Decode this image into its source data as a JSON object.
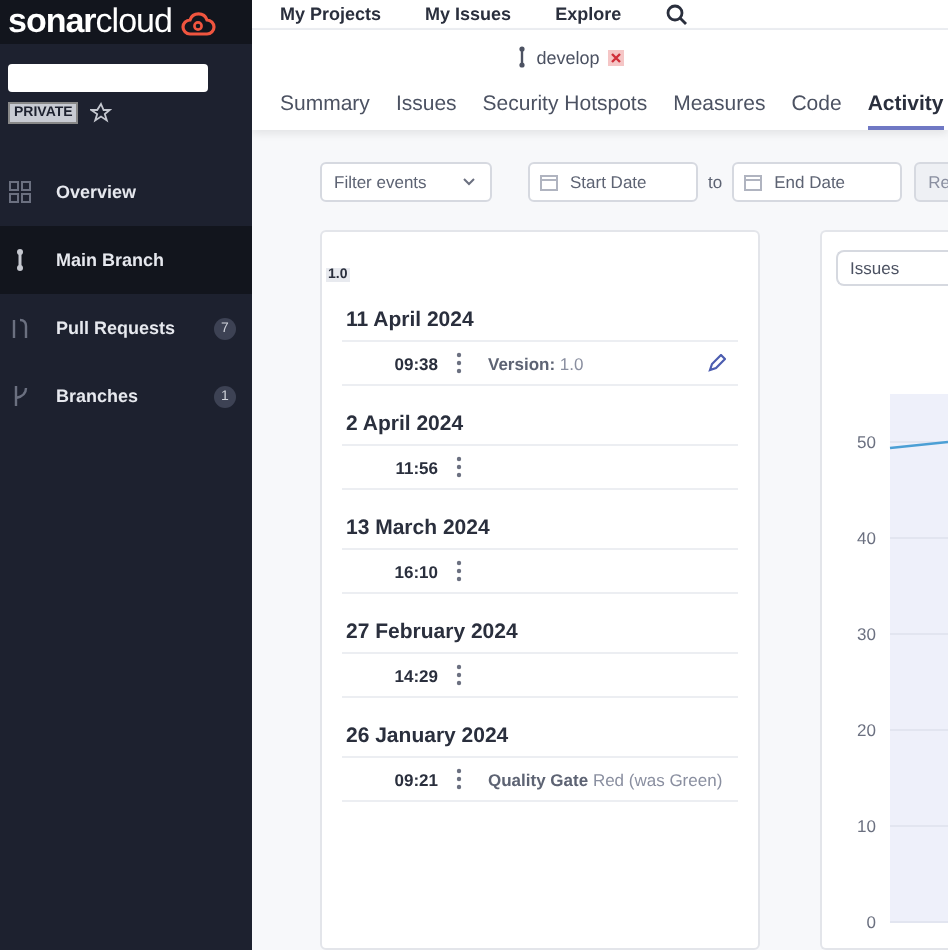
{
  "sidebar": {
    "logo": {
      "bold": "sonar",
      "light": "cloud"
    },
    "project_badge": "PRIVATE",
    "favorite": false,
    "items": [
      {
        "label": "Overview",
        "selected": false
      },
      {
        "label": "Main Branch",
        "selected": true
      },
      {
        "label": "Pull Requests",
        "selected": false,
        "count": "7"
      },
      {
        "label": "Branches",
        "selected": false,
        "count": "1"
      }
    ]
  },
  "top_nav": [
    "My Projects",
    "My Issues",
    "Explore"
  ],
  "branch": {
    "name": "develop",
    "failed": true
  },
  "tabs": [
    {
      "label": "Summary",
      "selected": false
    },
    {
      "label": "Issues",
      "selected": false
    },
    {
      "label": "Security Hotspots",
      "selected": false
    },
    {
      "label": "Measures",
      "selected": false
    },
    {
      "label": "Code",
      "selected": false
    },
    {
      "label": "Activity",
      "selected": true
    }
  ],
  "filters": {
    "event_filter": {
      "placeholder": "Filter events"
    },
    "start_date": {
      "placeholder": "Start Date"
    },
    "separator": "to",
    "end_date": {
      "placeholder": "End Date"
    },
    "reset_button": "Re"
  },
  "activity": {
    "version_tag": "1.0",
    "groups": [
      {
        "date": "11 April 2024",
        "entries": [
          {
            "time": "09:38",
            "event": {
              "kind": "version",
              "label": "Version:",
              "value": "1.0"
            }
          }
        ]
      },
      {
        "date": "2 April 2024",
        "entries": [
          {
            "time": "11:56"
          }
        ]
      },
      {
        "date": "13 March 2024",
        "entries": [
          {
            "time": "16:10"
          }
        ]
      },
      {
        "date": "27 February 2024",
        "entries": [
          {
            "time": "14:29"
          }
        ]
      },
      {
        "date": "26 January 2024",
        "entries": [
          {
            "time": "09:21",
            "event": {
              "kind": "quality_gate",
              "label": "Quality Gate",
              "value": "Red (was Green)"
            }
          }
        ]
      }
    ]
  },
  "graph": {
    "metric_select": "Issues",
    "y_axis_labels": [
      "50",
      "40",
      "30",
      "20",
      "10",
      "0"
    ]
  }
}
